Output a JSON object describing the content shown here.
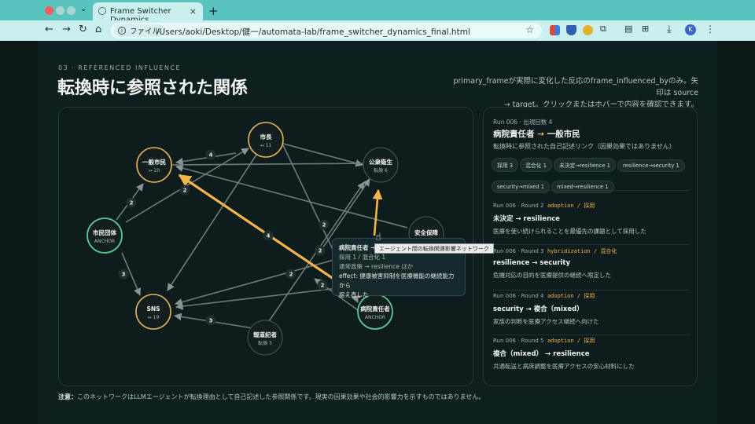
{
  "browser": {
    "tab_title": "Frame Switcher Dynamics",
    "close_glyph": "×",
    "new_tab_glyph": "+",
    "site_chip": "ファイル",
    "url": "/Users/aoki/Desktop/健一/automata-lab/frame_switcher_dynamics_final.html",
    "profile_initial": "K"
  },
  "header": {
    "eyebrow": "03 · REFERENCED INFLUENCE",
    "title": "転換時に参照された関係",
    "description_line1": "primary_frameが実際に変化した反応のframe_influenced_byのみ。矢印は source",
    "description_line2": "→ target。クリックまたはホバーで内容を確認できます。"
  },
  "graph": {
    "nodes": [
      {
        "id": "shimin",
        "label": "一般市民",
        "sub": "↔ 20",
        "kind": "gold"
      },
      {
        "id": "shicho",
        "label": "市長",
        "sub": "↔ 11",
        "kind": "gold"
      },
      {
        "id": "koshu",
        "label": "公衆衛生",
        "sub": "転換 6",
        "kind": "plain"
      },
      {
        "id": "dantai",
        "label": "市民団体",
        "sub": "ANCHOR",
        "kind": "anchor"
      },
      {
        "id": "anzen",
        "label": "安全保障",
        "sub": "",
        "kind": "plain"
      },
      {
        "id": "sns",
        "label": "SNS",
        "sub": "↔ 19",
        "kind": "gold"
      },
      {
        "id": "kisha",
        "label": "報道記者",
        "sub": "転換 3",
        "kind": "plain"
      },
      {
        "id": "byoin",
        "label": "病院責任者",
        "sub": "ANCHOR",
        "kind": "anchor"
      }
    ],
    "edge_weights": [
      "4",
      "2",
      "2",
      "2",
      "4",
      "2",
      "3",
      "2",
      "2",
      "3"
    ]
  },
  "tooltip": {
    "title": "病院責任者 →",
    "line2": "採用 1 / 混合化 1",
    "line3": "通常政策 → resilience ほか",
    "line4": "effect: 健康被害抑制を医療機能の継続能力から",
    "line5": "捉え直した",
    "hint": "エージェント間の転換関連影響ネットワーク"
  },
  "side": {
    "run": "Run 006 · 出現回数 4",
    "title_from": "病院責任者",
    "arrow": "→",
    "title_to": "一般市民",
    "subtitle": "転換時に参照された自己記述リンク（因果効果ではありません）",
    "tags": [
      "採用 3",
      "混合化 1",
      "未決定→resilience 1",
      "resilience→security 1",
      "security→mixed 1",
      "mixed→resilience 1"
    ],
    "items": [
      {
        "run": "Run 006 · Round 2",
        "kw": "adoption / 採用",
        "title": "未決定 → resilience",
        "body": "医療を使い続けられることを最優先の課題として採用した"
      },
      {
        "run": "Run 006 · Round 3",
        "kw": "hybridization / 混合化",
        "title": "resilience → security",
        "body": "危機対応の目的を医療提供の継続へ限定した"
      },
      {
        "run": "Run 006 · Round 4",
        "kw": "adoption / 採用",
        "title": "security → 複合（mixed）",
        "body": "家族の判断を医療アクセス継続へ向けた"
      },
      {
        "run": "Run 006 · Round 5",
        "kw": "adoption / 採用",
        "title": "複合（mixed） → resilience",
        "body": "共通転送と病床調整を医療アクセスの安心材料にした"
      }
    ]
  },
  "footer": {
    "note_label": "注意：",
    "note_text": "このネットワークはLLMエージェントが転換理由として自己記述した参照関係です。現実の因果効果や社会的影響力を示すものではありません。"
  },
  "colors": {
    "accent_gold": "#f0b64a",
    "anchor_green": "#58c79a",
    "chrome_teal": "#5bc3bd"
  }
}
